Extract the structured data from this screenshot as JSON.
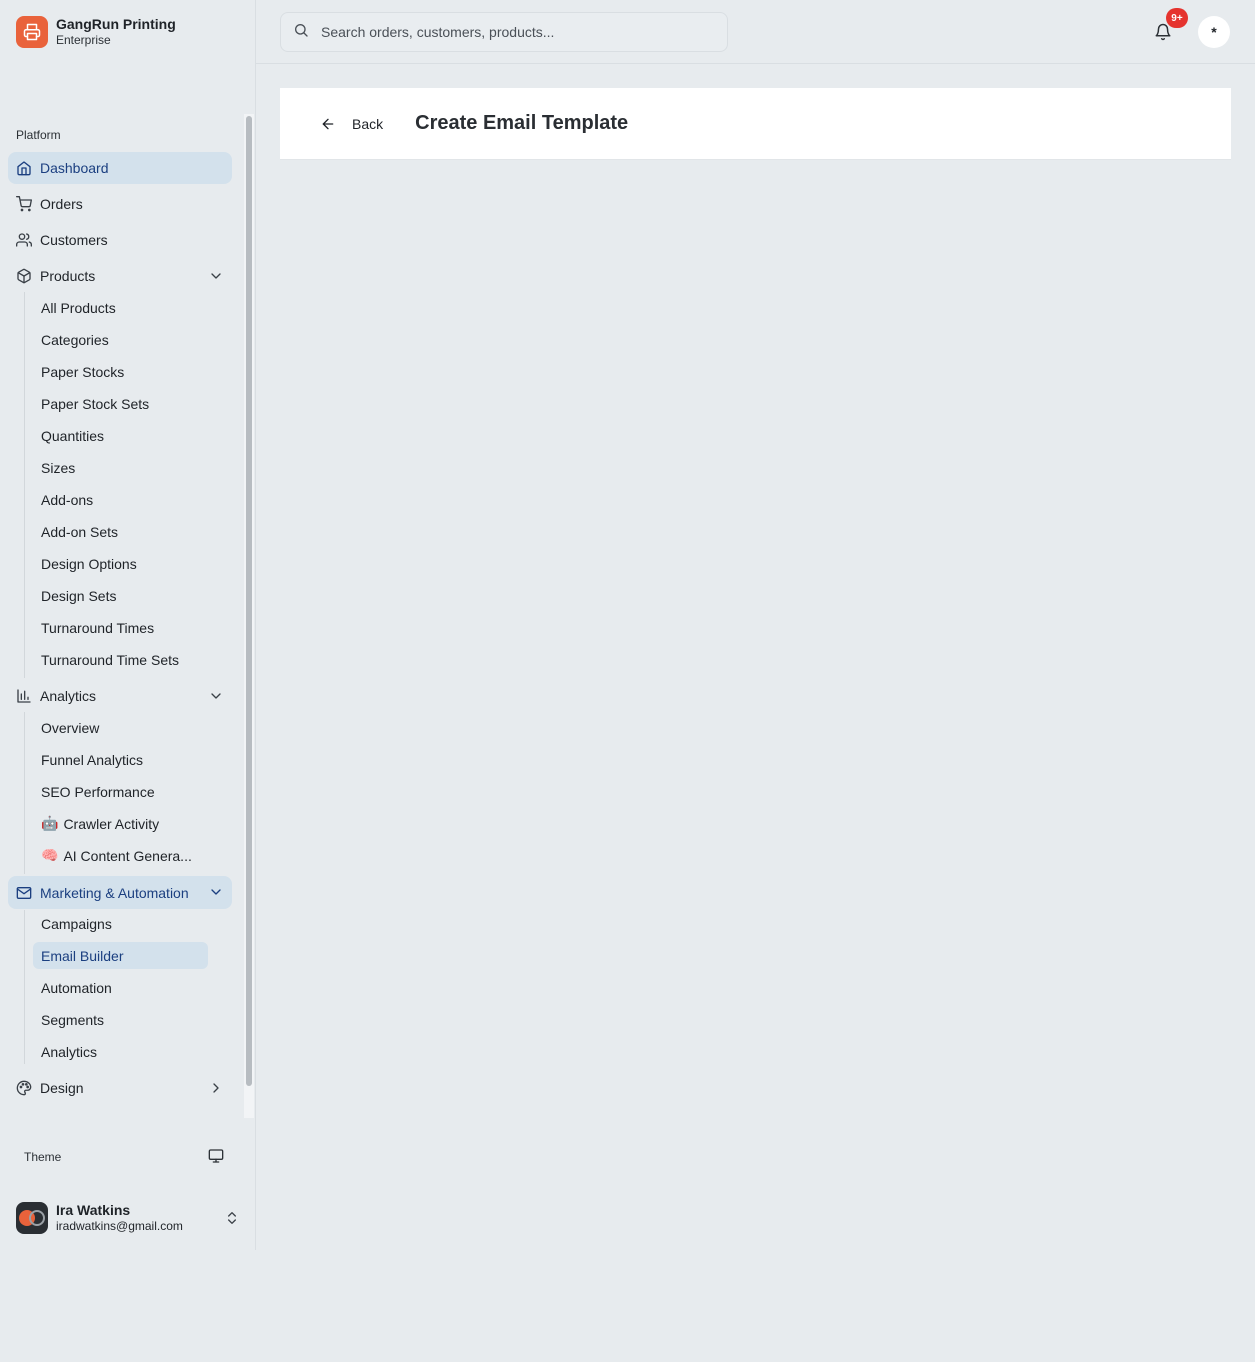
{
  "brand": {
    "name": "GangRun Printing",
    "plan": "Enterprise"
  },
  "sidebar": {
    "group_label": "Platform",
    "items": [
      {
        "label": "Dashboard",
        "icon": "home-icon"
      },
      {
        "label": "Orders",
        "icon": "cart-icon"
      },
      {
        "label": "Customers",
        "icon": "users-icon"
      },
      {
        "label": "Products",
        "icon": "package-icon"
      },
      {
        "label": "Analytics",
        "icon": "bar-chart-icon"
      },
      {
        "label": "Marketing & Automation",
        "icon": "mail-icon"
      },
      {
        "label": "Design",
        "icon": "palette-icon"
      }
    ],
    "products_sub": [
      "All Products",
      "Categories",
      "Paper Stocks",
      "Paper Stock Sets",
      "Quantities",
      "Sizes",
      "Add-ons",
      "Add-on Sets",
      "Design Options",
      "Design Sets",
      "Turnaround Times",
      "Turnaround Time Sets"
    ],
    "analytics_sub": [
      {
        "emoji": "",
        "label": "Overview"
      },
      {
        "emoji": "",
        "label": "Funnel Analytics"
      },
      {
        "emoji": "",
        "label": "SEO Performance"
      },
      {
        "emoji": "🤖",
        "label": "Crawler Activity"
      },
      {
        "emoji": "🧠",
        "label": "AI Content Genera..."
      }
    ],
    "marketing_sub": [
      "Campaigns",
      "Email Builder",
      "Automation",
      "Segments",
      "Analytics"
    ],
    "active_item": "Dashboard",
    "active_sub": "Email Builder"
  },
  "theme": {
    "label": "Theme",
    "icon": "monitor-icon"
  },
  "user": {
    "name": "Ira Watkins",
    "email": "iradwatkins@gmail.com"
  },
  "topbar": {
    "search_placeholder": "Search orders, customers, products...",
    "notification_badge": "9+",
    "user_button": "*"
  },
  "page": {
    "back_label": "Back",
    "title": "Create Email Template"
  },
  "colors": {
    "accent": "#e9623b",
    "active_bg": "#d3e1ec",
    "active_text": "#1b3f80",
    "badge": "#e5332e"
  }
}
